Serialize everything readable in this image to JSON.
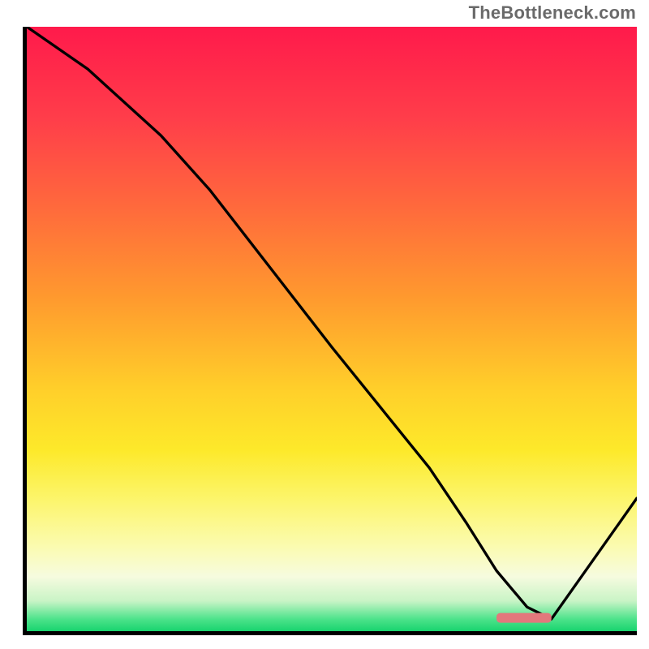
{
  "watermark": "TheBottleneck.com",
  "chart_data": {
    "type": "line",
    "title": "",
    "xlabel": "",
    "ylabel": "",
    "xlim": [
      0,
      100
    ],
    "ylim": [
      0,
      100
    ],
    "grid": false,
    "legend": false,
    "background": "heatmap-gradient (red high penalty → green low penalty)",
    "series": [
      {
        "name": "bottleneck-curve",
        "x": [
          0,
          10,
          22,
          30,
          40,
          50,
          58,
          66,
          72,
          77,
          82,
          86,
          100
        ],
        "y": [
          100,
          93,
          82,
          73,
          60,
          47,
          37,
          27,
          18,
          10,
          4,
          2,
          22
        ]
      }
    ],
    "annotations": [
      {
        "name": "optimal-zone-marker",
        "shape": "rounded-rect",
        "x_range": [
          77,
          86
        ],
        "y": 2,
        "color": "#e2787c"
      }
    ]
  }
}
